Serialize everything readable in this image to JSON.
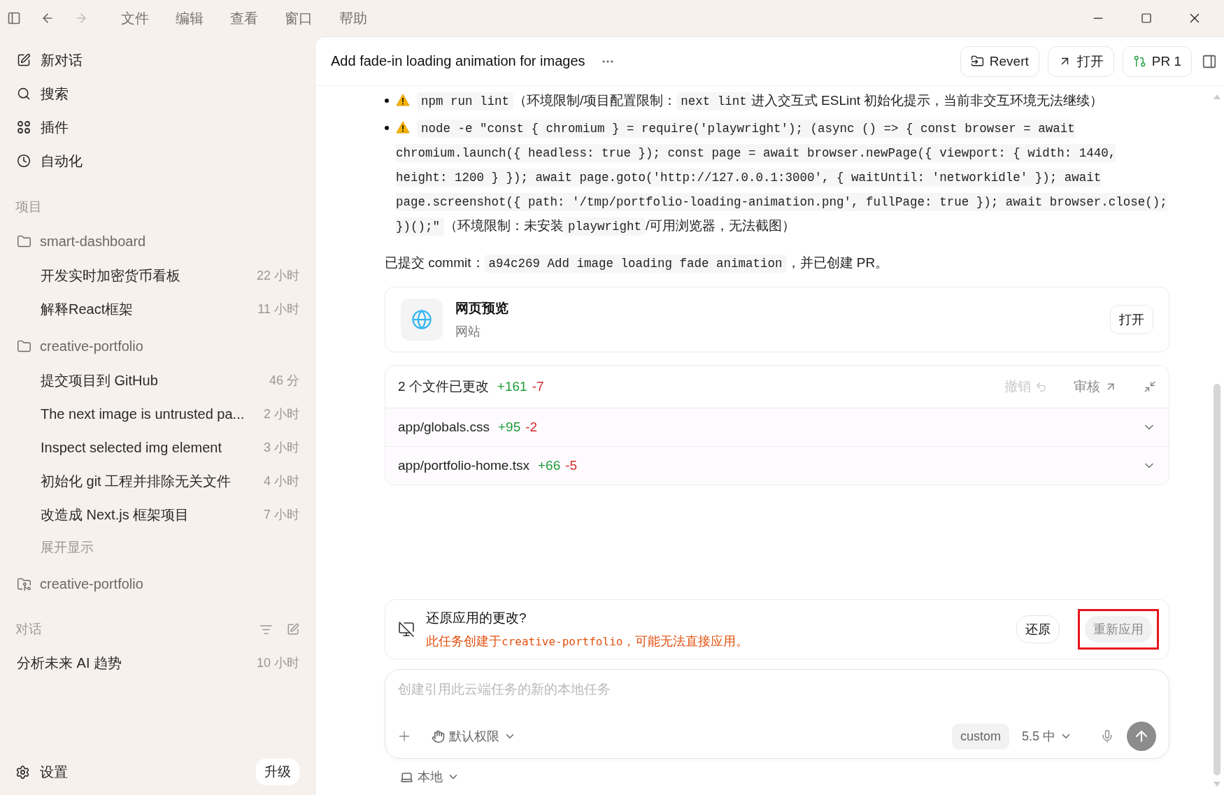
{
  "menubar": {
    "items": [
      "文件",
      "编辑",
      "查看",
      "窗口",
      "帮助"
    ]
  },
  "sidebar": {
    "nav": [
      {
        "label": "新对话"
      },
      {
        "label": "搜索"
      },
      {
        "label": "插件"
      },
      {
        "label": "自动化"
      }
    ],
    "projects_heading": "项目",
    "projects": [
      {
        "kind": "folder",
        "name": "smart-dashboard",
        "threads": [
          {
            "title": "开发实时加密货币看板",
            "time": "22 小时"
          },
          {
            "title": "解释React框架",
            "time": "11 小时"
          }
        ]
      },
      {
        "kind": "folder",
        "name": "creative-portfolio",
        "threads": [
          {
            "title": "提交项目到 GitHub",
            "time": "46 分"
          },
          {
            "title": "The next image is untrusted pa...",
            "time": "2 小时"
          },
          {
            "title": "Inspect selected img element",
            "time": "3 小时"
          },
          {
            "title": "初始化 git 工程并排除无关文件",
            "time": "4 小时"
          },
          {
            "title": "改造成 Next.js 框架项目",
            "time": "7 小时"
          }
        ],
        "more": "展开显示"
      },
      {
        "kind": "cloud",
        "name": "creative-portfolio"
      }
    ],
    "chats_heading": "对话",
    "chats": [
      {
        "title": "分析未来 AI 趋势",
        "time": "10 小时"
      }
    ],
    "settings": "设置",
    "upgrade": "升级"
  },
  "header": {
    "title": "Add fade-in loading animation for images",
    "buttons": [
      {
        "kind": "revert",
        "label": "Revert"
      },
      {
        "kind": "open",
        "label": "打开"
      },
      {
        "kind": "pr",
        "label": "PR 1"
      }
    ]
  },
  "message": {
    "bullets": [
      {
        "warning": true,
        "segments": [
          {
            "kind": "code",
            "text": "npm run lint"
          },
          {
            "kind": "text",
            "text": "（环境限制/项目配置限制："
          },
          {
            "kind": "code",
            "text": "next lint"
          },
          {
            "kind": "text",
            "text": "进入交互式 ESLint 初始化提示，当前非交互环境无法继续）"
          }
        ]
      },
      {
        "warning": true,
        "segments": [
          {
            "kind": "code",
            "text": "node -e \"const { chromium } = require('playwright'); (async () => { const browser = await chromium.launch({ headless: true }); const page = await browser.newPage({ viewport: { width: 1440, height: 1200 } }); await page.goto('http://127.0.0.1:3000', { waitUntil: 'networkidle' }); await page.screenshot({ path: '/tmp/portfolio-loading-animation.png', fullPage: true }); await browser.close(); })();\""
          },
          {
            "kind": "text",
            "text": "（环境限制：未安装"
          },
          {
            "kind": "code",
            "text": "playwright"
          },
          {
            "kind": "text",
            "text": "/可用浏览器，无法截图）"
          }
        ]
      }
    ],
    "commit": [
      {
        "kind": "text",
        "text": "已提交 commit："
      },
      {
        "kind": "code",
        "text": "a94c269 Add image loading fade animation"
      },
      {
        "kind": "text",
        "text": "，并已创建 PR。"
      }
    ]
  },
  "preview": {
    "title": "网页预览",
    "subtitle": "网站",
    "button": "打开"
  },
  "changes": {
    "summary": "2 个文件已更改",
    "added": "+161",
    "removed": "-7",
    "undo": {
      "label": "撤销",
      "disabled": true
    },
    "review": "审核",
    "files": [
      {
        "path": "app/globals.css",
        "added": "+95",
        "removed": "-2"
      },
      {
        "path": "app/portfolio-home.tsx",
        "added": "+66",
        "removed": "-5"
      }
    ]
  },
  "revert_banner": {
    "title": "还原应用的更改?",
    "warning": [
      {
        "kind": "text",
        "text": "此任务创建于"
      },
      {
        "kind": "code",
        "text": "creative-portfolio"
      },
      {
        "kind": "text",
        "text": "，可能无法直接应用。"
      }
    ],
    "buttons": [
      {
        "label": "还原",
        "disabled": false,
        "highlighted": false
      },
      {
        "label": "重新应用",
        "disabled": true,
        "highlighted": true
      }
    ]
  },
  "composer": {
    "placeholder": "创建引用此云端任务的新的本地任务",
    "permission": "默认权限",
    "model_chip": "custom",
    "model": "5.5 中"
  },
  "footer": {
    "location": "本地"
  }
}
